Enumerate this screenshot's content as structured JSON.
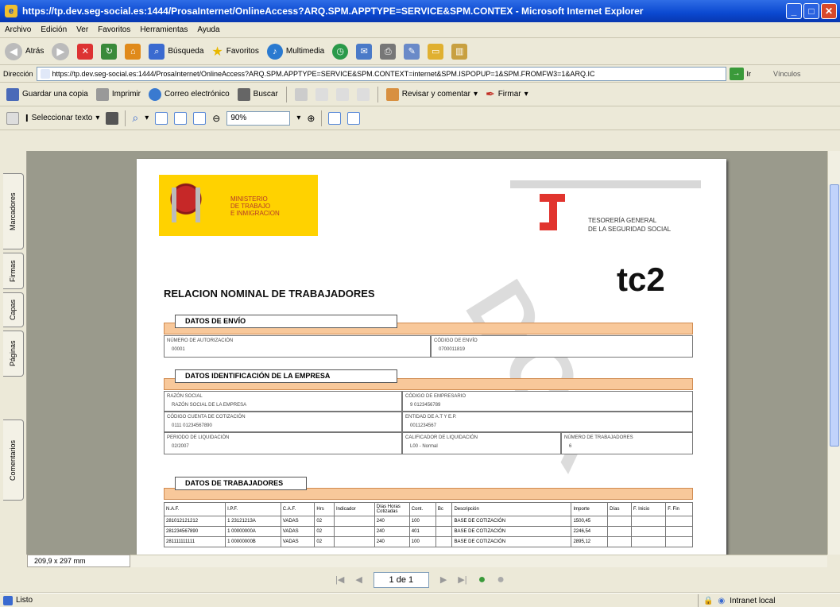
{
  "window": {
    "title": "https://tp.dev.seg-social.es:1444/ProsaInternet/OnlineAccess?ARQ.SPM.APPTYPE=SERVICE&SPM.CONTEX - Microsoft Internet Explorer"
  },
  "menu": [
    "Archivo",
    "Edición",
    "Ver",
    "Favoritos",
    "Herramientas",
    "Ayuda"
  ],
  "nav": {
    "back": "Atrás",
    "search": "Búsqueda",
    "favorites": "Favoritos",
    "media": "Multimedia"
  },
  "address": {
    "label": "Dirección",
    "url": "https://tp.dev.seg-social.es:1444/ProsaInternet/OnlineAccess?ARQ.SPM.APPTYPE=SERVICE&SPM.CONTEXT=internet&SPM.ISPOPUP=1&SPM.FROMFW3=1&ARQ.IC",
    "go": "Ir",
    "links": "Vínculos"
  },
  "pdf_toolbar1": {
    "save": "Guardar una copia",
    "print": "Imprimir",
    "email": "Correo electrónico",
    "search": "Buscar",
    "review": "Revisar y comentar",
    "sign": "Firmar"
  },
  "pdf_toolbar2": {
    "select_text": "Seleccionar texto",
    "zoom": "90%"
  },
  "side_tabs": [
    "Marcadores",
    "Firmas",
    "Capas",
    "Páginas",
    "Comentarios"
  ],
  "doc": {
    "ministerio": [
      "MINISTERIO",
      "DE TRABAJO",
      "E INMIGRACION"
    ],
    "tgss": [
      "TESORERÍA GENERAL",
      "DE LA SEGURIDAD SOCIAL"
    ],
    "tc2": "tc2",
    "title": "RELACION NOMINAL DE TRABAJADORES",
    "sec_envio": "DATOS DE ENVÍO",
    "f_num_aut": "NÚMERO DE AUTORIZACIÓN",
    "f_num_aut_val": "00001",
    "f_cod_envio": "CÓDIGO DE ENVÍO",
    "f_cod_envio_val": "0700011819",
    "sec_empresa": "DATOS IDENTIFICACIÓN DE LA EMPRESA",
    "f_razon": "RAZÓN SOCIAL",
    "f_razon_val": "RAZÓN SOCIAL DE LA EMPRESA",
    "f_cod_emp": "CÓDIGO DE EMPRESARIO",
    "f_cod_emp_val": "9 0123456789",
    "f_ccc": "CÓDIGO CUENTA DE COTIZACIÓN",
    "f_ccc_val": "0111 01234567890",
    "f_entidad": "ENTIDAD DE A.T Y E.P.",
    "f_entidad_val": "0011234567",
    "f_periodo": "PERIODO DE LIQUIDACIÓN",
    "f_periodo_val": "02/2007",
    "f_calif": "CALIFICADOR DE LIQUIDACIÓN",
    "f_calif_val": "L00 - Normal",
    "f_num_trab": "NÚMERO DE TRABAJADORES",
    "f_num_trab_val": "6",
    "sec_trab": "DATOS DE TRABAJADORES",
    "watermark": "DOR",
    "table_header": [
      "N.A.F.",
      "I.P.F.",
      "C.A.F.",
      "Hrs",
      "Indicador",
      "Días Horas Cotizadas",
      "Cont.",
      "Bc",
      "Descripción",
      "Importe",
      "Días",
      "F. Inicio",
      "F. Fin"
    ],
    "table_rows": [
      [
        "281012121212",
        "1 23121213A",
        "VADAS",
        "02",
        "",
        "240",
        "100",
        "",
        "BASE DE COTIZACIÓN",
        "1500,45",
        "",
        "",
        ""
      ],
      [
        "281234567890",
        "1 00000000A",
        "VADAS",
        "02",
        "",
        "240",
        "401",
        "",
        "BASE DE COTIZACIÓN",
        "2246,54",
        "",
        "",
        ""
      ],
      [
        "281111111111",
        "1 00000000B",
        "VADAS",
        "02",
        "",
        "240",
        "100",
        "",
        "BASE DE COTIZACIÓN",
        "2895,12",
        "",
        "",
        ""
      ]
    ]
  },
  "page_size": "209,9 x 297 mm",
  "pagenav": {
    "page_text": "1 de 1"
  },
  "status": {
    "left": "Listo",
    "zone": "Intranet local"
  }
}
